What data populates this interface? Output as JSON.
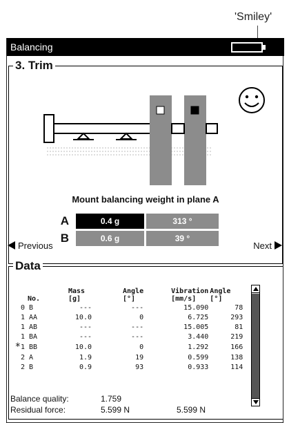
{
  "callout": {
    "text": "'Smiley'"
  },
  "window": {
    "title": "Balancing",
    "battery_icon": "battery-icon"
  },
  "trim": {
    "title": "3. Trim",
    "instruction": "Mount balancing weight in plane A",
    "smiley_icon": "smiley-face-icon",
    "planes": [
      {
        "letter": "A",
        "mass": "0.4 g",
        "angle": "313 °",
        "active": true
      },
      {
        "letter": "B",
        "mass": "0.6 g",
        "angle": "39 °",
        "active": false
      }
    ]
  },
  "nav": {
    "previous": "Previous",
    "next": "Next"
  },
  "data": {
    "title": "Data",
    "columns": [
      {
        "line1": "No.",
        "line2": ""
      },
      {
        "line1": "Mass",
        "line2": "[g]"
      },
      {
        "line1": "Angle",
        "line2": "[°]"
      },
      {
        "line1": "Vibration",
        "line2": "[mm/s]"
      },
      {
        "line1": "Angle",
        "line2": "[°]"
      }
    ],
    "rows": [
      {
        "mark": "",
        "no": "0 B",
        "mass": "---",
        "angle": "---",
        "vibration": "15.090",
        "vib_angle": "78"
      },
      {
        "mark": "",
        "no": "1 AA",
        "mass": "10.0",
        "angle": "0",
        "vibration": "6.725",
        "vib_angle": "293"
      },
      {
        "mark": "",
        "no": "1 AB",
        "mass": "---",
        "angle": "---",
        "vibration": "15.005",
        "vib_angle": "81"
      },
      {
        "mark": "",
        "no": "1 BA",
        "mass": "---",
        "angle": "---",
        "vibration": "3.440",
        "vib_angle": "219"
      },
      {
        "mark": "*",
        "no": "1 BB",
        "mass": "10.0",
        "angle": "0",
        "vibration": "1.292",
        "vib_angle": "166"
      },
      {
        "mark": "",
        "no": "2 A",
        "mass": "1.9",
        "angle": "19",
        "vibration": "0.599",
        "vib_angle": "138"
      },
      {
        "mark": "",
        "no": "2 B",
        "mass": "0.9",
        "angle": "93",
        "vibration": "0.933",
        "vib_angle": "114"
      }
    ]
  },
  "summary": {
    "balance_quality_label": "Balance quality:",
    "balance_quality_value": "1.759",
    "residual_force_label": "Residual force:",
    "residual_force_value_a": "5.599 N",
    "residual_force_value_b": "5.599 N"
  }
}
